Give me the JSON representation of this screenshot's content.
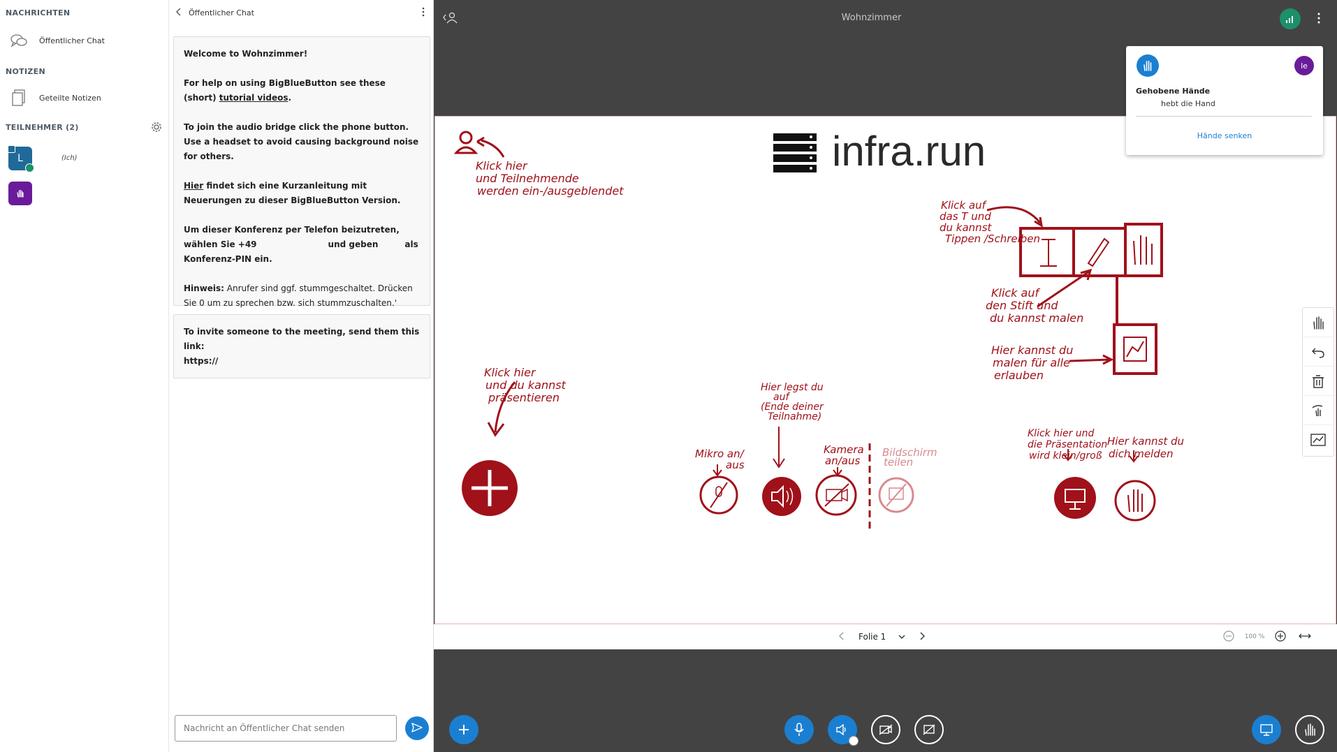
{
  "userlist": {
    "messages_title": "NACHRICHTEN",
    "public_chat_label": "Öffentlicher Chat",
    "notes_title": "NOTIZEN",
    "shared_notes_label": "Geteilte Notizen",
    "participants_title": "TEILNEHMER (2)",
    "users": [
      {
        "initial": "L",
        "you_label": "(Ich)",
        "color": "#1f6a99"
      },
      {
        "initial": "",
        "color": "#6a1b9a"
      }
    ]
  },
  "chat": {
    "header": "Öffentlicher Chat",
    "welcome_prefix": "Welcome to ",
    "welcome_room": "Wohnzimmer",
    "welcome_suffix": "!",
    "help_prefix": "For help on using BigBlueButton see these (short) ",
    "help_link": "tutorial videos",
    "help_suffix": ".",
    "audio_text": "To join the audio bridge click the phone button. Use a headset to avoid causing background noise for others.",
    "hier_link": "Hier",
    "hier_text": " findet sich eine Kurzanleitung mit Neuerungen zu dieser BigBlueButton Version.",
    "phone_1": "Um dieser Konferenz per Telefon beizutreten, wählen Sie +49",
    "phone_2": "und geben",
    "phone_3": "als Konferenz-PIN ein.",
    "hint_label": "Hinweis:",
    "hint_text": " Anrufer sind ggf. stummgeschaltet. Drücken Sie 0 um zu sprechen bzw. sich stummzuschalten.'",
    "invite_text": "To invite someone to the meeting, send them this link:",
    "invite_link": "https://",
    "input_placeholder": "Nachricht an Öffentlicher Chat senden"
  },
  "main": {
    "room_title": "Wohnzimmer",
    "hands": {
      "title": "Gehobene Hände",
      "subtitle": "hebt die Hand",
      "avatar_initials": "le",
      "lower_button": "Hände senken"
    },
    "slide": {
      "logo_text": "infra.run",
      "annotations": {
        "users_toggle": [
          "Klick hier",
          "und Teilnehmende",
          "werden ein-/ausgeblendet"
        ],
        "text_tool": [
          "Klick auf",
          "das T und",
          "du kannst",
          "Tippen /Schreiben"
        ],
        "pen_tool": [
          "Klick auf",
          "den Stift und",
          "du kannst malen"
        ],
        "multi_user": [
          "Hier kannst du",
          "malen für alle",
          "erlauben"
        ],
        "present": [
          "Klick hier",
          "und du kannst",
          "präsentieren"
        ],
        "leave_audio": [
          "Hier legst du",
          "auf",
          "(Ende deiner",
          "Teilnahme)"
        ],
        "mic": [
          "Mikro an/",
          "aus"
        ],
        "camera": [
          "Kamera",
          "an/aus"
        ],
        "screenshare": [
          "Bildschirm",
          "teilen"
        ],
        "presentation_size": [
          "Klick hier und",
          "die Präsentation",
          "wird klein/groß"
        ],
        "raise_hand": [
          "Hier kannst du",
          "dich melden"
        ]
      }
    },
    "slide_toolbar": {
      "slide_label": "Folie 1",
      "zoom_label": "100 %"
    }
  }
}
